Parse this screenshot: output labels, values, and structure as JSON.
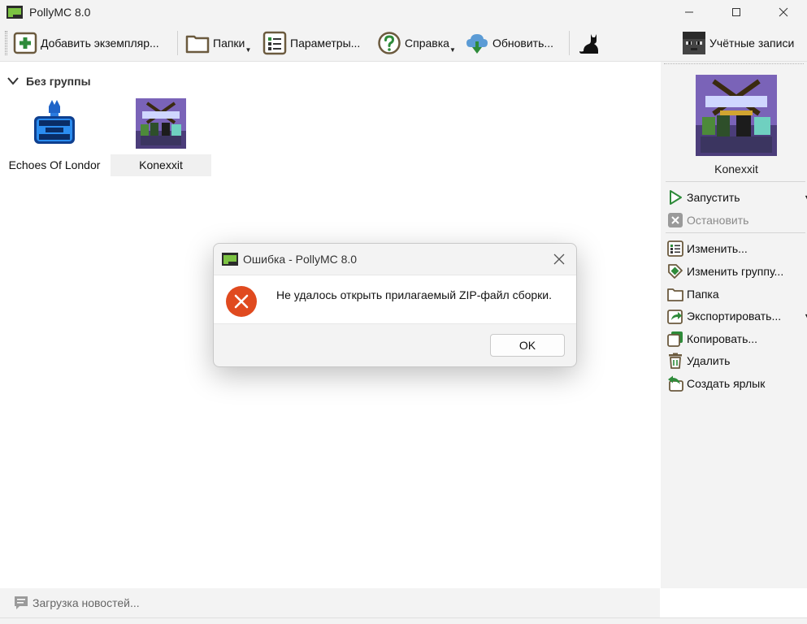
{
  "window": {
    "title": "PollyMC 8.0"
  },
  "toolbar": {
    "add_instance": "Добавить экземпляр...",
    "folders": "Папки",
    "settings": "Параметры...",
    "help": "Справка",
    "update": "Обновить...",
    "accounts": "Учётные записи"
  },
  "main": {
    "group_name": "Без группы",
    "instances": [
      {
        "name": "Echoes Of Londor"
      },
      {
        "name": "Konexxit"
      }
    ]
  },
  "side": {
    "instance_name": "Konexxit",
    "actions": {
      "launch": "Запустить",
      "stop": "Остановить",
      "edit": "Изменить...",
      "change_group": "Изменить группу...",
      "folder": "Папка",
      "export": "Экспортировать...",
      "copy": "Копировать...",
      "delete": "Удалить",
      "shortcut": "Создать ярлык"
    }
  },
  "status": {
    "news": "Загрузка новостей..."
  },
  "dialog": {
    "title": "Ошибка - PollyMC 8.0",
    "message": "Не удалось открыть прилагаемый ZIP-файл сборки.",
    "ok_label": "OK"
  },
  "colors": {
    "accent_green": "#2e7d32",
    "error_red": "#e04a1f",
    "window_bg": "#f3f3f3"
  }
}
